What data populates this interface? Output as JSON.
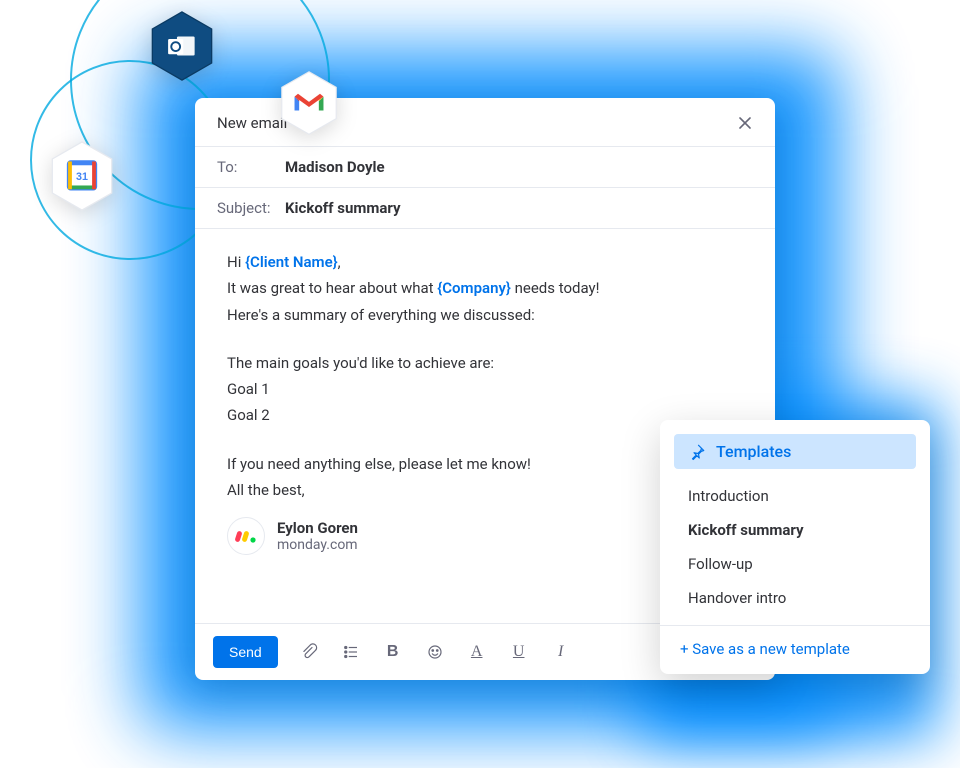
{
  "compose": {
    "title": "New email",
    "to_label": "To:",
    "to_value": "Madison Doyle",
    "subject_label": "Subject:",
    "subject_value": "Kickoff summary",
    "body": {
      "greeting_pre": "Hi ",
      "greeting_ph": "{Client Name}",
      "greeting_post": ",",
      "line2_pre": "It was great to hear about what ",
      "line2_ph": "{Company}",
      "line2_post": " needs today!",
      "line3": "Here's a summary of everything we discussed:",
      "line4": "The main goals you'd like to achieve are:",
      "goal1": "Goal 1",
      "goal2": "Goal 2",
      "closing1": "If you need anything else, please let me know!",
      "closing2": "All the best,"
    },
    "signature": {
      "name": "Eylon Goren",
      "org": "monday.com"
    },
    "send_label": "Send",
    "format_chars": {
      "bold": "B",
      "color": "A",
      "under": "U",
      "italic": "I"
    }
  },
  "templates": {
    "header": "Templates",
    "items": [
      "Introduction",
      "Kickoff summary",
      "Follow-up",
      "Handover intro"
    ],
    "selected": "Kickoff summary",
    "footer": "+ Save as a new template"
  },
  "badges": {
    "outlook": "outlook-icon",
    "calendar": "google-calendar-icon",
    "gmail": "gmail-icon",
    "calendar_day": "31"
  }
}
